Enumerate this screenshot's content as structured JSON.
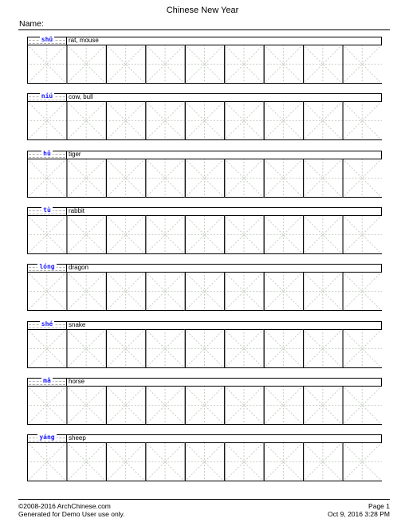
{
  "document": {
    "title": "Chinese New Year",
    "name_label": "Name:"
  },
  "worksheet": {
    "cells_per_row": 9,
    "rows": [
      {
        "pinyin": "shǔ",
        "meaning": "rat, mouse"
      },
      {
        "pinyin": "niú",
        "meaning": "cow, bull"
      },
      {
        "pinyin": "hǔ",
        "meaning": "tiger"
      },
      {
        "pinyin": "tù",
        "meaning": "rabbit"
      },
      {
        "pinyin": "lóng",
        "meaning": "dragon"
      },
      {
        "pinyin": "shé",
        "meaning": "snake"
      },
      {
        "pinyin": "mǎ",
        "meaning": "horse"
      },
      {
        "pinyin": "yáng",
        "meaning": "sheep"
      }
    ]
  },
  "footer": {
    "copyright": "©2008-2016 ArchChinese.com",
    "generated_for": "Generated for Demo User use only.",
    "page": "Page 1",
    "timestamp": "Oct 9, 2016 3:28 PM"
  },
  "colors": {
    "pinyin": "#1a1aff",
    "guide_lines": "#c8cfc4",
    "border": "#000000"
  }
}
